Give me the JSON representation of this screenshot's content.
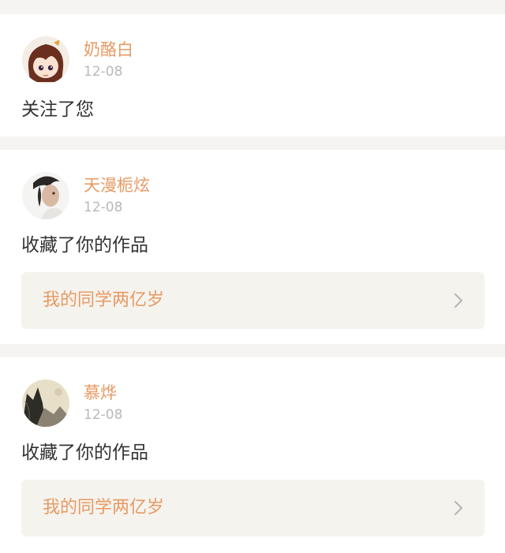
{
  "notifications": [
    {
      "user": "奶酪白",
      "date": "12-08",
      "action": "关注了您",
      "avatar_icon": "anime-girl-avatar-icon"
    },
    {
      "user": "天漫栀炫",
      "date": "12-08",
      "action": "收藏了你的作品",
      "work_title": "我的同学两亿岁",
      "avatar_icon": "woman-portrait-avatar-icon"
    },
    {
      "user": "慕烨",
      "date": "12-08",
      "action": "收藏了你的作品",
      "work_title": "我的同学两亿岁",
      "avatar_icon": "ink-landscape-avatar-icon"
    }
  ],
  "colors": {
    "accent": "#e79a63",
    "muted": "#b9b9b9",
    "text": "#333333",
    "card_link_bg": "#f5f3ee",
    "page_bg": "#f6f4f3"
  }
}
